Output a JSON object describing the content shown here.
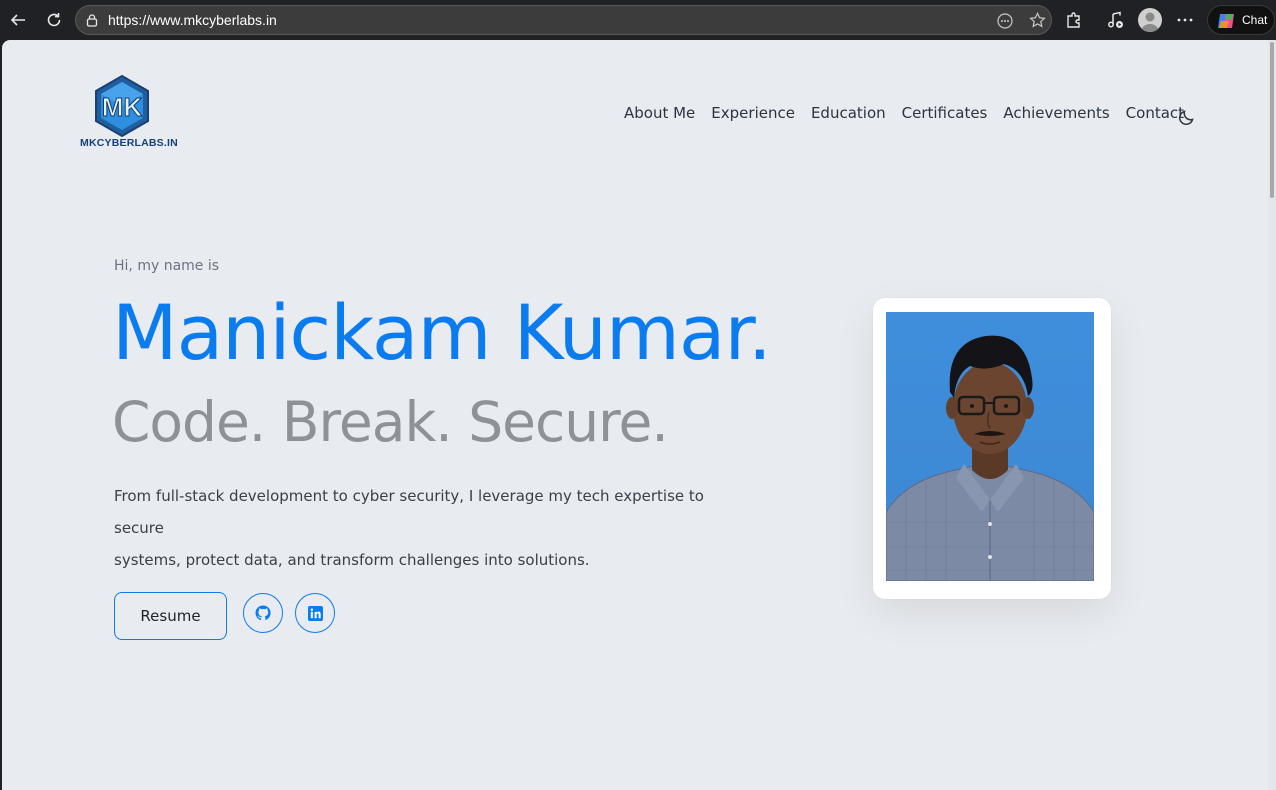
{
  "browser": {
    "url": "https://www.mkcyberlabs.in",
    "chat_label": "Chat"
  },
  "logo": {
    "mark": "MK",
    "text": "MKCYBERLABS.IN"
  },
  "nav": {
    "items": [
      "About Me",
      "Experience",
      "Education",
      "Certificates",
      "Achievements",
      "Contact"
    ]
  },
  "hero": {
    "greeting": "Hi, my name is",
    "name": "Manickam Kumar.",
    "tagline": "Code. Break. Secure.",
    "intro_line1": "From full-stack development to cyber security, I leverage my tech expertise to secure",
    "intro_line2": "systems, protect data, and transform challenges into solutions.",
    "resume_label": "Resume"
  },
  "social": [
    "github-icon",
    "linkedin-icon"
  ],
  "colors": {
    "accent": "#0a7cf0",
    "page_bg": "#e8ebef",
    "tagline": "#8e9196"
  }
}
